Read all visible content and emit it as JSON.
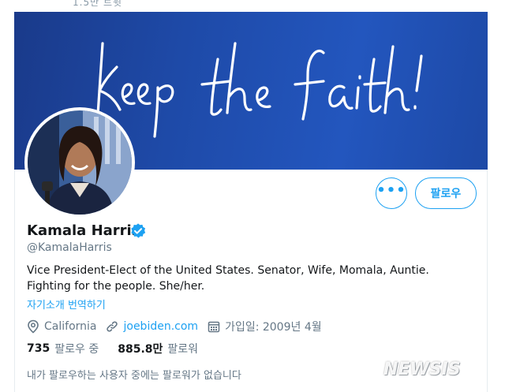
{
  "top_strip_text": "1.5만 트윗",
  "banner": {
    "script_text": "keep the faith!"
  },
  "profile": {
    "name": "Kamala Harris",
    "handle": "@KamalaHarris",
    "bio": "Vice President-Elect of the United States. Senator, Wife, Momala, Auntie. Fighting for the people. She/her.",
    "translate_label": "자기소개 번역하기",
    "location": "California",
    "website": "joebiden.com",
    "joined": "가입일: 2009년 4월",
    "verified": true
  },
  "buttons": {
    "more_label": "•••",
    "follow_label": "팔로우"
  },
  "stats": {
    "following_count": "735",
    "following_label": "팔로우 중",
    "followers_count": "885.8만",
    "followers_label": "팔로워"
  },
  "no_common_followers": "내가 팔로우하는 사용자 중에는 팔로워가 없습니다",
  "watermark": "NEWSIS",
  "colors": {
    "accent": "#1da1f2",
    "banner": "#1e4aa8",
    "text": "#14171a",
    "muted": "#657786"
  },
  "icons": [
    "location-pin-icon",
    "link-icon",
    "calendar-icon",
    "verified-badge-icon",
    "more-dots-icon"
  ]
}
